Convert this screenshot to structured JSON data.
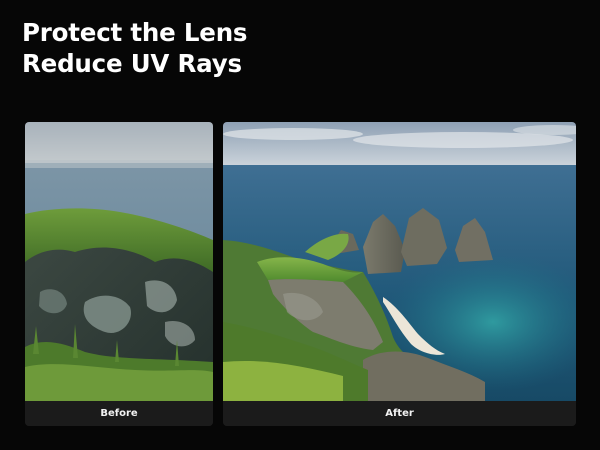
{
  "headline": {
    "line1": "Protect the Lens",
    "line2": "Reduce UV Rays"
  },
  "comparison": {
    "before": {
      "label": "Before",
      "image": "hazy-coastal-cliff-photo"
    },
    "after": {
      "label": "After",
      "image": "clear-coastal-sea-stacks-photo"
    }
  },
  "colors": {
    "background": "#060606",
    "text": "#ffffff",
    "caption_bar": "#1b1b1b"
  }
}
